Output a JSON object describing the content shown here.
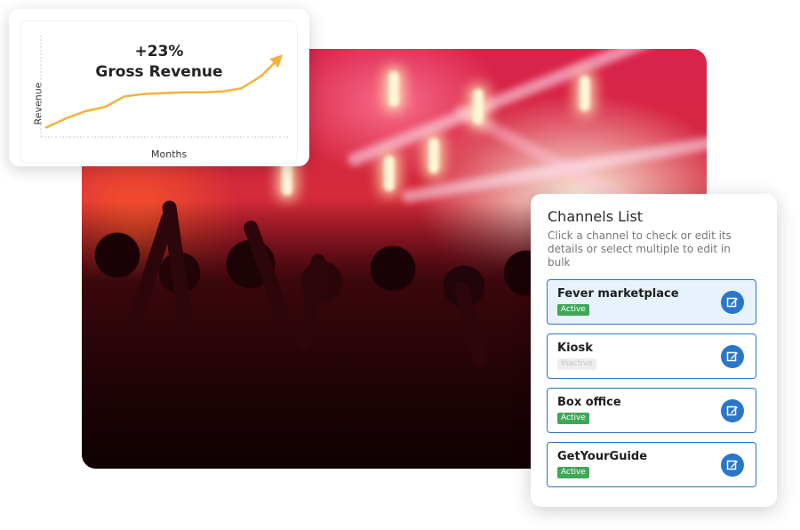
{
  "revenue_card": {
    "change": "+23%",
    "title": "Gross Revenue",
    "chart_data": {
      "type": "line",
      "title": "Gross Revenue",
      "xlabel": "Months",
      "ylabel": "Revenue",
      "x": [
        0,
        1,
        2,
        3,
        4,
        5,
        6,
        7,
        8,
        9,
        10,
        11,
        12
      ],
      "series": [
        {
          "values": [
            5,
            16,
            25,
            30,
            43,
            46,
            47,
            48,
            48,
            49,
            53,
            68,
            92
          ]
        }
      ],
      "ylim": [
        0,
        100
      ],
      "grid": false,
      "line_color": "#f5b13b",
      "axis_color": "#cccccc"
    }
  },
  "channels": {
    "title": "Channels List",
    "subtitle": "Click a channel to check or edit its details or select multiple to edit in bulk",
    "items": [
      {
        "name": "Fever marketplace",
        "status": "Active",
        "selected": true
      },
      {
        "name": "Kiosk",
        "status": "Inactive",
        "selected": false
      },
      {
        "name": "Box office",
        "status": "Active",
        "selected": false
      },
      {
        "name": "GetYourGuide",
        "status": "Active",
        "selected": false
      }
    ],
    "edit_icon": "edit-icon",
    "accent_color": "#2a77c9",
    "active_color": "#3ea857"
  },
  "photo": {
    "description_icon": "concert-crowd-image"
  }
}
